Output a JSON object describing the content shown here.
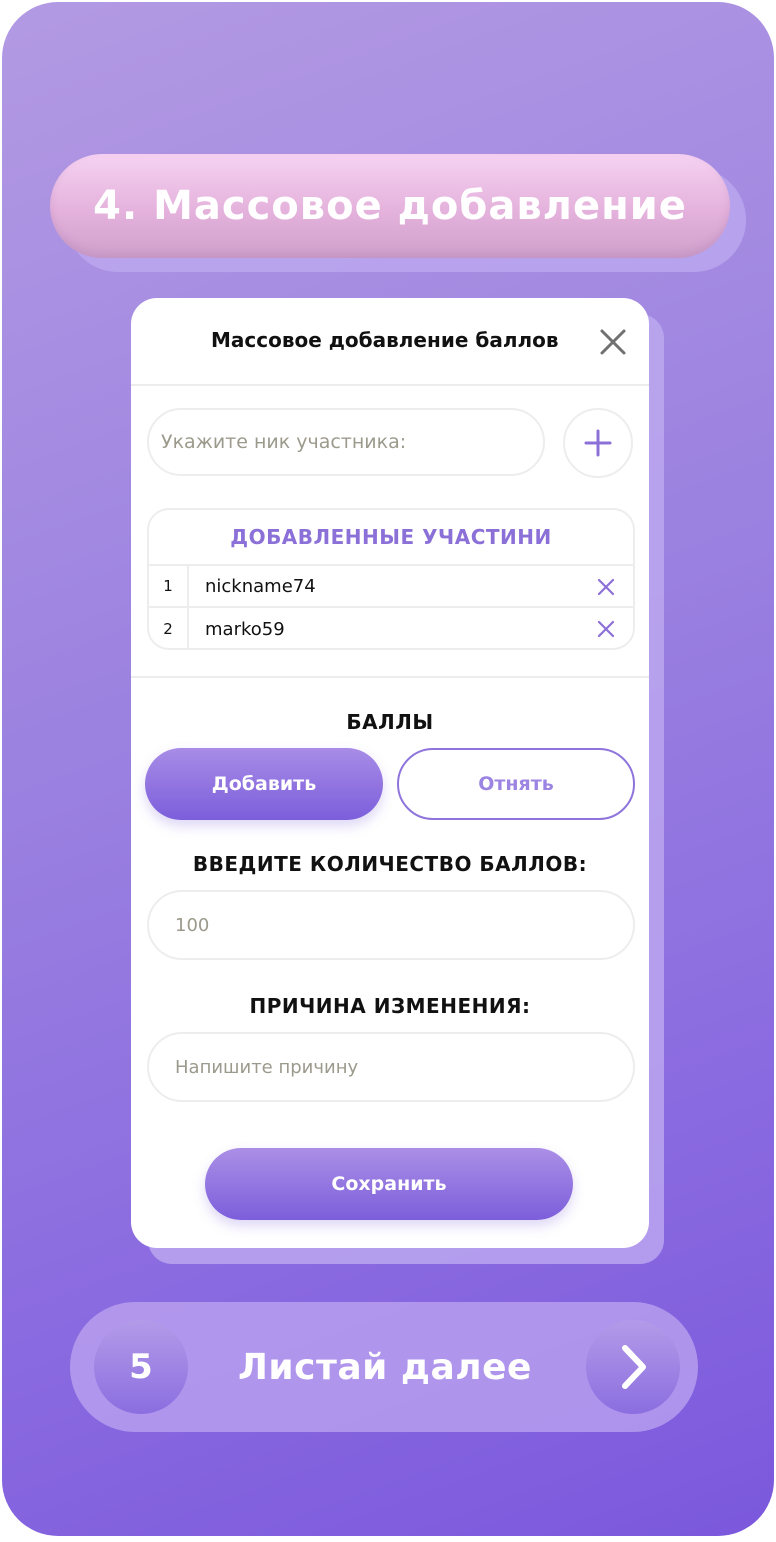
{
  "step": {
    "title": "4. Массовое добавление"
  },
  "modal": {
    "title": "Массовое добавление баллов",
    "close_icon": "close-icon",
    "nick_input": {
      "placeholder": "Укажите ник участника:"
    },
    "add_member_icon": "plus-icon",
    "members": {
      "title": "ДОБАВЛЕННЫЕ УЧАСТИНИ",
      "rows": [
        {
          "num": "1",
          "name": "nickname74"
        },
        {
          "num": "2",
          "name": "marko59"
        }
      ]
    },
    "points_label": "БАЛЛЫ",
    "add_button": "Добавить",
    "subtract_button": "Отнять",
    "amount_label": "ВВЕДИТЕ КОЛИЧЕСТВО БАЛЛОВ:",
    "amount_value": "100",
    "reason_label": "ПРИЧИНА ИЗМЕНЕНИЯ:",
    "reason_placeholder": "Напишите причину",
    "save_button": "Сохранить"
  },
  "next": {
    "number": "5",
    "label": "Листай далее",
    "arrow_icon": "chevron-right-icon"
  },
  "colors": {
    "accent": "#8b70d8",
    "background": "#9a80e0",
    "title_pill": "#e4b2dc"
  }
}
